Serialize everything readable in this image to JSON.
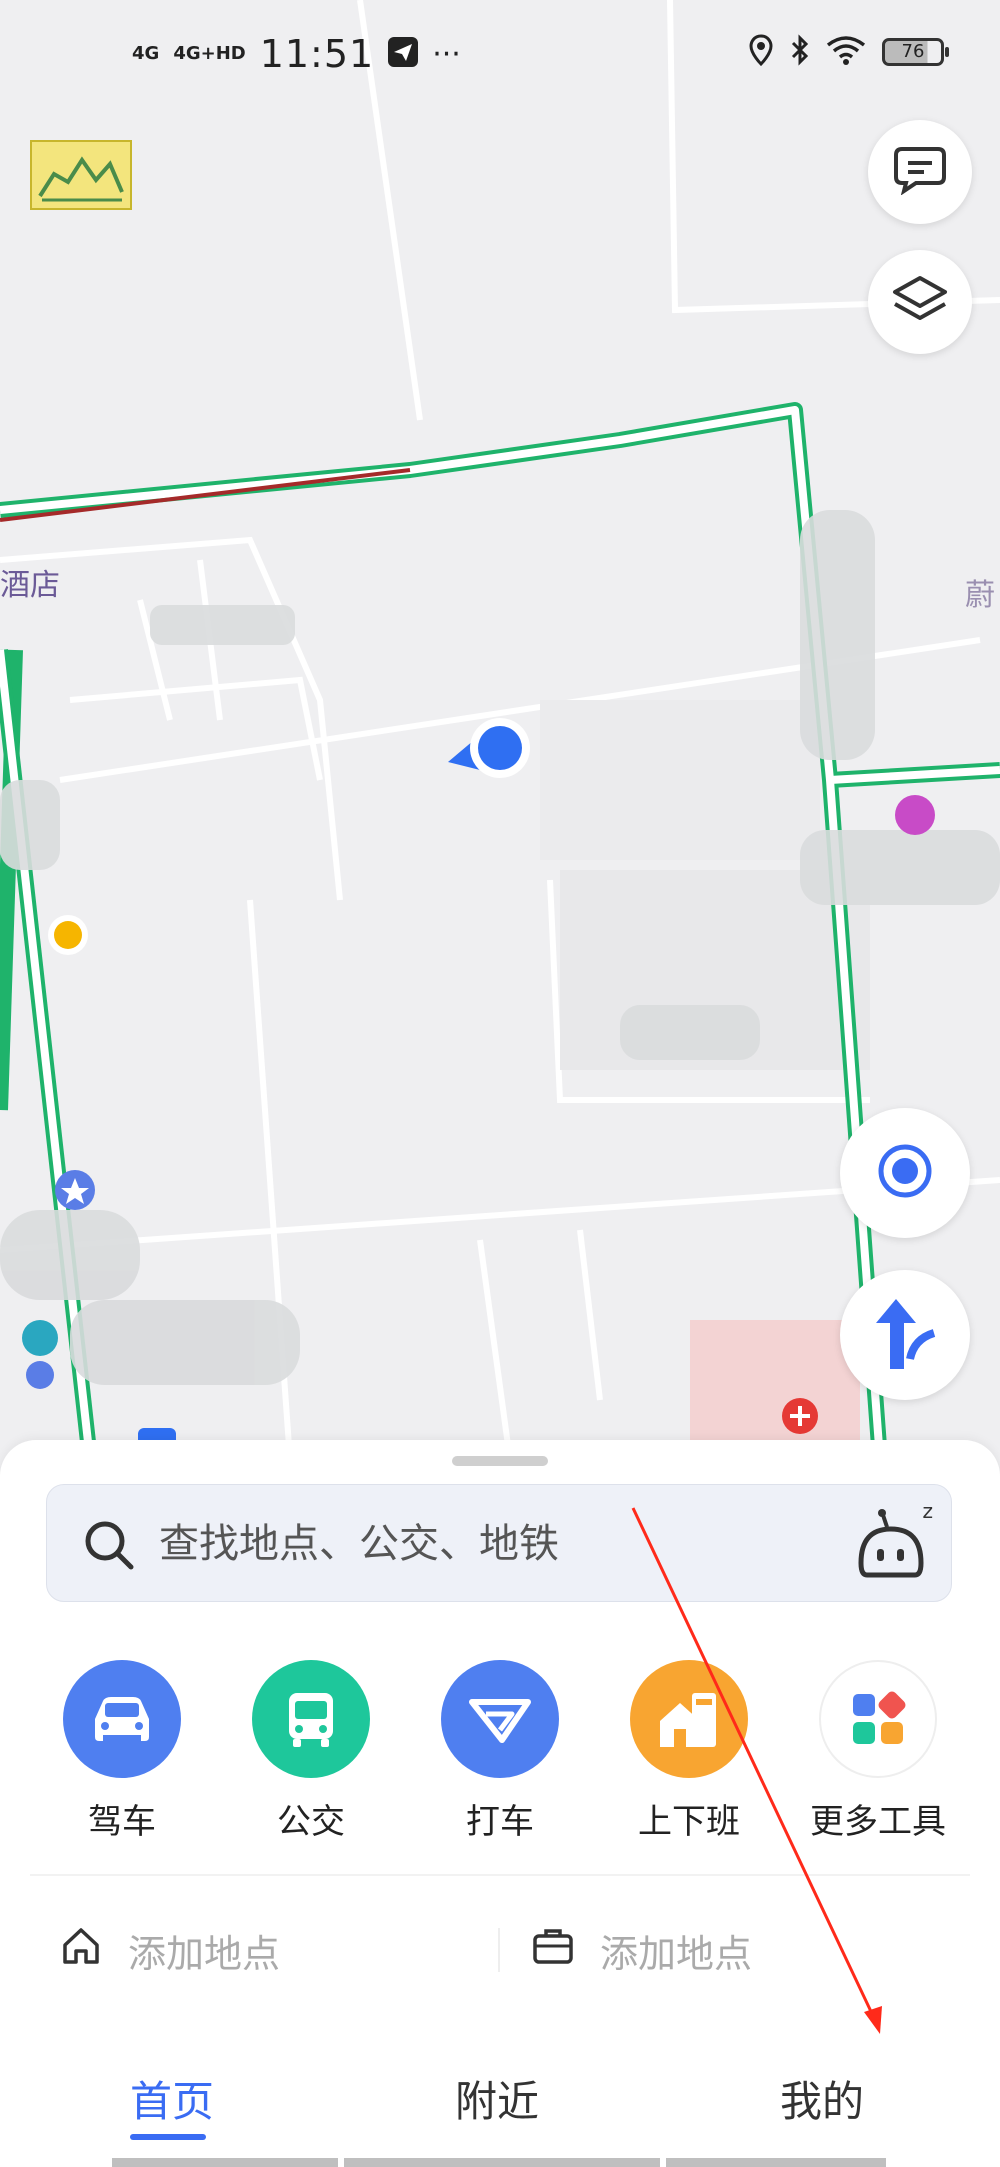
{
  "status_bar": {
    "network_1": "4G",
    "network_2": "4G+HD",
    "time": "11:51",
    "more": "···",
    "battery": "76"
  },
  "map": {
    "poi_labels": [
      "酒店",
      "蔚"
    ]
  },
  "search": {
    "placeholder": "查找地点、公交、地铁",
    "assistant_badge": "z"
  },
  "tools": [
    {
      "label": "驾车",
      "icon": "car-icon",
      "color": "#4f7ff0"
    },
    {
      "label": "公交",
      "icon": "bus-icon",
      "color": "#1ec79b"
    },
    {
      "label": "打车",
      "icon": "taxi-icon",
      "color": "#4f7ff0"
    },
    {
      "label": "上下班",
      "icon": "commute-icon",
      "color": "#f8a531"
    },
    {
      "label": "更多工具",
      "icon": "grid-icon",
      "color": "#ffffff"
    }
  ],
  "places": {
    "home_label": "添加地点",
    "work_label": "添加地点"
  },
  "tabs": {
    "home": "首页",
    "nearby": "附近",
    "mine": "我的"
  },
  "colors": {
    "accent": "#3a6cf3",
    "road_green": "#1fb36b",
    "road_red": "#a52a2a",
    "annotation_arrow": "#ff2a1a"
  }
}
